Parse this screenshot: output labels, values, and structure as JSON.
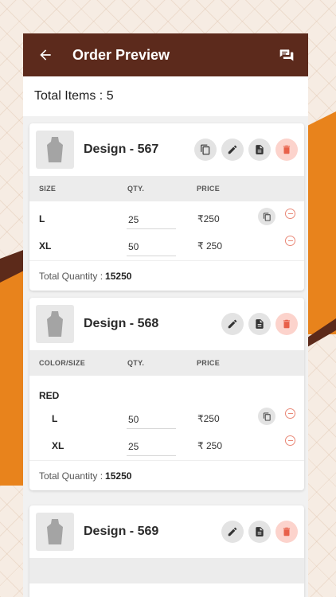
{
  "header": {
    "title": "Order Preview"
  },
  "summary": {
    "total_items": "Total Items : 5"
  },
  "cards": [
    {
      "title": "Design - 567",
      "columns": [
        "SIZE",
        "QTY.",
        "PRICE"
      ],
      "rows": [
        {
          "size": "L",
          "qty": "25",
          "price": "₹250"
        },
        {
          "size": "XL",
          "qty": "50",
          "price": "₹ 250"
        }
      ],
      "total_label": "Total Quantity :",
      "total_value": "15250"
    },
    {
      "title": "Design - 568",
      "columns": [
        "COLOR/SIZE",
        "QTY.",
        "PRICE"
      ],
      "color": "RED",
      "rows": [
        {
          "size": "L",
          "qty": "50",
          "price": "₹250"
        },
        {
          "size": "XL",
          "qty": "25",
          "price": "₹ 250"
        }
      ],
      "total_label": "Total Quantity :",
      "total_value": "15250"
    },
    {
      "title": "Design - 569"
    }
  ],
  "colors": {
    "topbar": "#5c2a1c",
    "accent": "#e8831c",
    "delete": "#e8604a"
  },
  "icons": [
    "back-arrow-icon",
    "chat-icon",
    "dress-icon",
    "copy-icon",
    "edit-icon",
    "document-icon",
    "delete-icon",
    "minus-circle-icon"
  ]
}
